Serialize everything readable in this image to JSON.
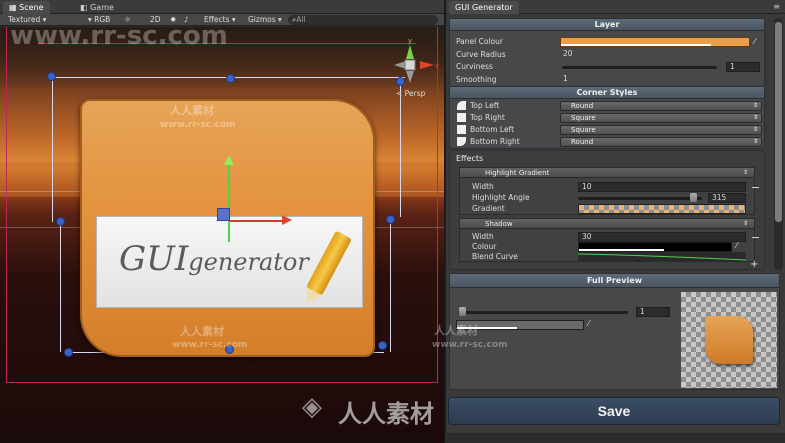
{
  "scene_panel": {
    "tabs": [
      {
        "label": "Scene",
        "icon": "scene-icon",
        "active": true
      },
      {
        "label": "Game",
        "icon": "game-icon",
        "active": false
      }
    ],
    "toolbar": {
      "draw_mode": "Textured",
      "render_mode": "RGB",
      "mode_2d": "2D",
      "effects": "Effects",
      "gizmos": "Gizmos",
      "search_placeholder": "All"
    },
    "persp_label": "< Persp",
    "gui_logo": {
      "main": "GUI",
      "secondary": "generator"
    }
  },
  "inspector": {
    "tab_label": "GUI Generator",
    "layer": {
      "title": "Layer",
      "panel_colour_label": "Panel Colour",
      "panel_colour": "#e8a04c",
      "curve_radius_label": "Curve Radius",
      "curve_radius": "20",
      "curviness_label": "Curviness",
      "curviness": "1",
      "smoothing_label": "Smoothing",
      "smoothing": "1"
    },
    "corner_styles": {
      "title": "Corner Styles",
      "rows": [
        {
          "label": "Top Left",
          "value": "Round",
          "icon": "round-corner-icon"
        },
        {
          "label": "Top Right",
          "value": "Square",
          "icon": "square-corner-icon"
        },
        {
          "label": "Bottom Left",
          "value": "Square",
          "icon": "square-corner-icon"
        },
        {
          "label": "Bottom Right",
          "value": "Round",
          "icon": "round-corner-icon"
        }
      ]
    },
    "effects": {
      "title": "Effects",
      "highlight": {
        "type": "Highlight Gradient",
        "width_label": "Width",
        "width": "10",
        "angle_label": "Highlight Angle",
        "angle": "315",
        "gradient_label": "Gradient"
      },
      "shadow": {
        "type": "Shadow",
        "width_label": "Width",
        "width": "30",
        "colour_label": "Colour",
        "blend_label": "Blend Curve"
      },
      "add_label": "+",
      "remove_label": "−"
    },
    "preview": {
      "title": "Full Preview",
      "value": "1"
    },
    "save_label": "Save"
  },
  "watermarks": {
    "site": "www.rr-sc.com",
    "cn": "人人素材"
  },
  "colors": {
    "accent": "#5c6f84",
    "selection": "#3b62c8",
    "magenta_frame": "#c0255a",
    "y_axis": "#52d14a",
    "x_axis": "#d83a2c"
  }
}
